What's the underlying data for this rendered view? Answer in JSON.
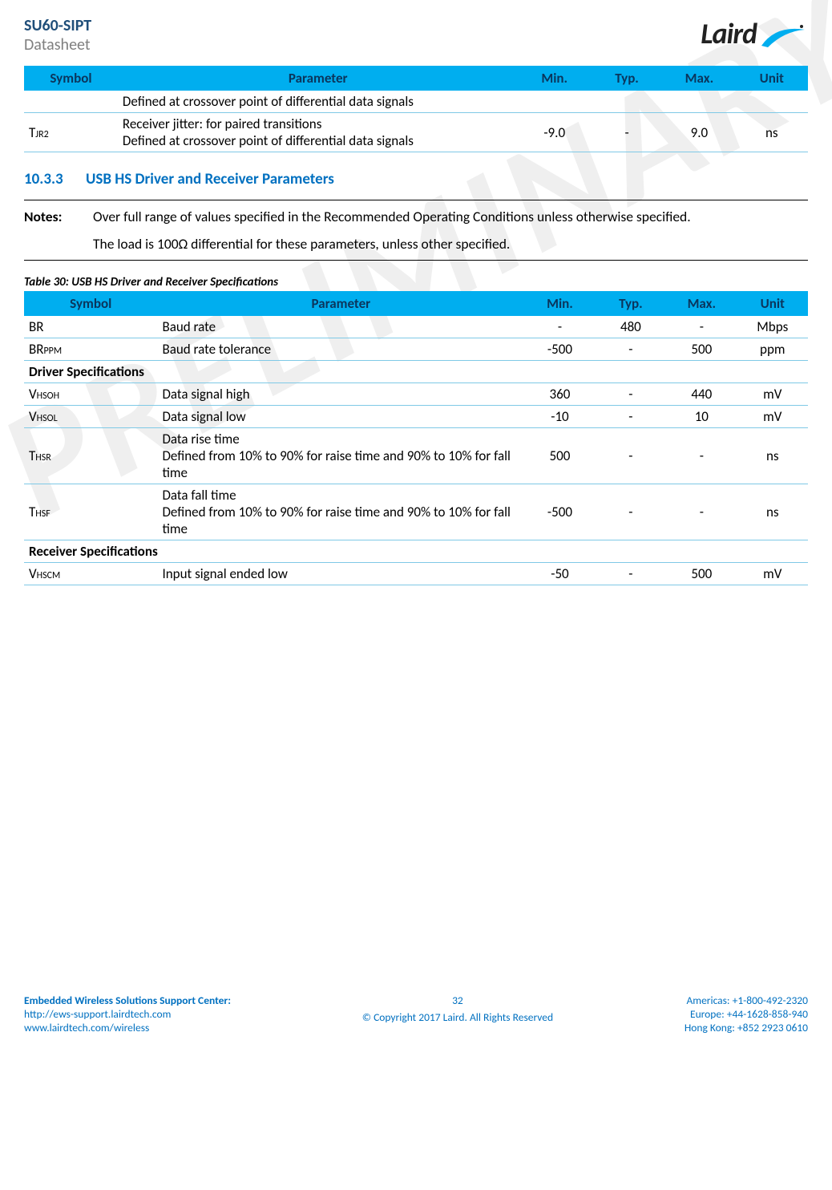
{
  "header": {
    "title": "SU60-SIPT",
    "subtitle": "Datasheet",
    "logo_text": "Laird"
  },
  "table1": {
    "headers": {
      "symbol": "Symbol",
      "parameter": "Parameter",
      "min": "Min.",
      "typ": "Typ.",
      "max": "Max.",
      "unit": "Unit"
    },
    "rows": [
      {
        "symbol": "",
        "param": "Defined at crossover point of differential data signals",
        "min": "",
        "typ": "",
        "max": "",
        "unit": ""
      },
      {
        "symbol_main": "T",
        "symbol_sub": "JR2",
        "param": "Receiver jitter: for paired transitions\nDefined at crossover point of differential data signals",
        "min": "-9.0",
        "typ": "-",
        "max": "9.0",
        "unit": "ns"
      }
    ]
  },
  "section": {
    "number": "10.3.3",
    "title": "USB HS Driver and Receiver Parameters"
  },
  "notes": {
    "label": "Notes:",
    "p1": "Over full range of values specified in the Recommended Operating Conditions unless otherwise specified.",
    "p2": "The load is 100Ω differential for these parameters, unless other specified."
  },
  "table2_caption": "Table 30: USB HS Driver and Receiver Specifications",
  "table2": {
    "headers": {
      "symbol": "Symbol",
      "parameter": "Parameter",
      "min": "Min.",
      "typ": "Typ.",
      "max": "Max.",
      "unit": "Unit"
    },
    "rows": [
      {
        "type": "data",
        "symbol_main": "BR",
        "symbol_sub": "",
        "param": "Baud rate",
        "min": "-",
        "typ": "480",
        "max": "-",
        "unit": "Mbps"
      },
      {
        "type": "data",
        "symbol_main": "BR",
        "symbol_sub": "PPM",
        "param": "Baud rate tolerance",
        "min": "-500",
        "typ": "-",
        "max": "500",
        "unit": "ppm"
      },
      {
        "type": "section",
        "label": "Driver Specifications"
      },
      {
        "type": "data",
        "symbol_main": "V",
        "symbol_sub": "HSOH",
        "param": "Data signal high",
        "min": "360",
        "typ": "-",
        "max": "440",
        "unit": "mV"
      },
      {
        "type": "data",
        "symbol_main": "V",
        "symbol_sub": "HSOL",
        "param": "Data signal low",
        "min": "-10",
        "typ": "-",
        "max": "10",
        "unit": "mV"
      },
      {
        "type": "data",
        "symbol_main": "T",
        "symbol_sub": "HSR",
        "param": "Data rise time\nDefined from 10% to 90% for raise time and 90% to 10% for fall time",
        "min": "500",
        "typ": "-",
        "max": "-",
        "unit": "ns"
      },
      {
        "type": "data",
        "symbol_main": "T",
        "symbol_sub": "HSF",
        "param": "Data fall time\nDefined from 10% to 90% for raise time and 90% to 10% for fall time",
        "min": "-500",
        "typ": "-",
        "max": "-",
        "unit": "ns"
      },
      {
        "type": "section",
        "label": "Receiver Specifications"
      },
      {
        "type": "data",
        "symbol_main": "V",
        "symbol_sub": "HSCM",
        "param": "Input signal ended low",
        "min": "-50",
        "typ": "-",
        "max": "500",
        "unit": "mV"
      }
    ]
  },
  "footer": {
    "support_center": "Embedded Wireless Solutions Support Center:",
    "url1": "http://ews-support.lairdtech.com",
    "url2": "www.lairdtech.com/wireless",
    "page": "32",
    "copyright": "© Copyright 2017 Laird. All Rights Reserved",
    "americas": "Americas: +1-800-492-2320",
    "europe": "Europe: +44-1628-858-940",
    "hk": "Hong Kong: +852 2923 0610"
  }
}
